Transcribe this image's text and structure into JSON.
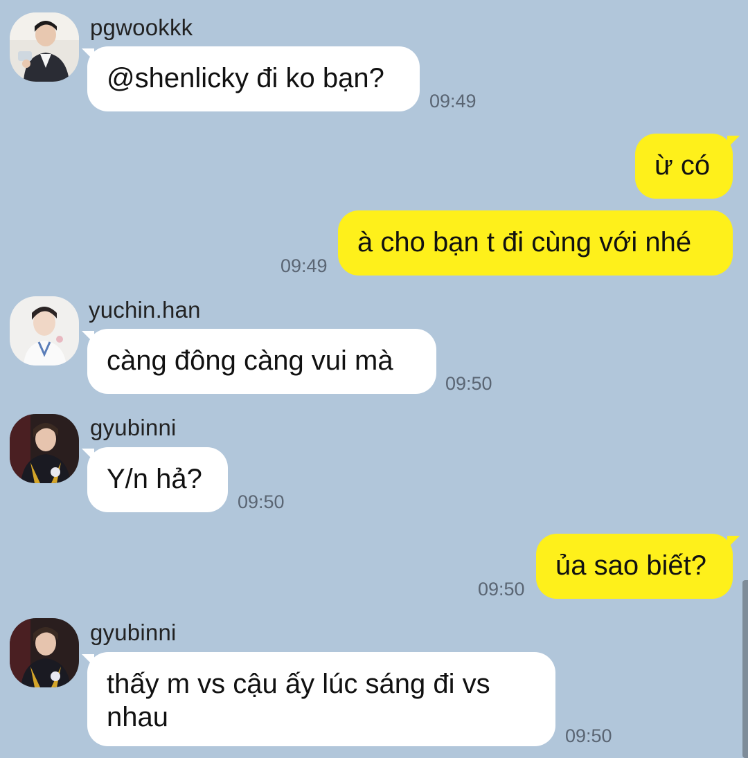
{
  "messages": [
    {
      "sender": "pgwookkk",
      "text": "@shenlicky đi ko bạn?",
      "time": "09:49"
    },
    {
      "text": "ừ có"
    },
    {
      "text": "à cho bạn t đi cùng với nhé",
      "time": "09:49"
    },
    {
      "sender": "yuchin.han",
      "text": "càng đông càng vui mà",
      "time": "09:50"
    },
    {
      "sender": "gyubinni",
      "text": "Y/n hả?",
      "time": "09:50"
    },
    {
      "text": "ủa sao biết?",
      "time": "09:50"
    },
    {
      "sender": "gyubinni",
      "text": "thấy m vs cậu ấy lúc sáng đi vs nhau",
      "time": "09:50"
    }
  ],
  "colors": {
    "background": "#b1c6da",
    "incoming_bubble": "#ffffff",
    "outgoing_bubble": "#fef01b"
  },
  "icons": {
    "avatar_pgwookkk": "profile-photo-avatar",
    "avatar_yuchin": "profile-photo-avatar",
    "avatar_gyubinni": "profile-photo-avatar"
  }
}
